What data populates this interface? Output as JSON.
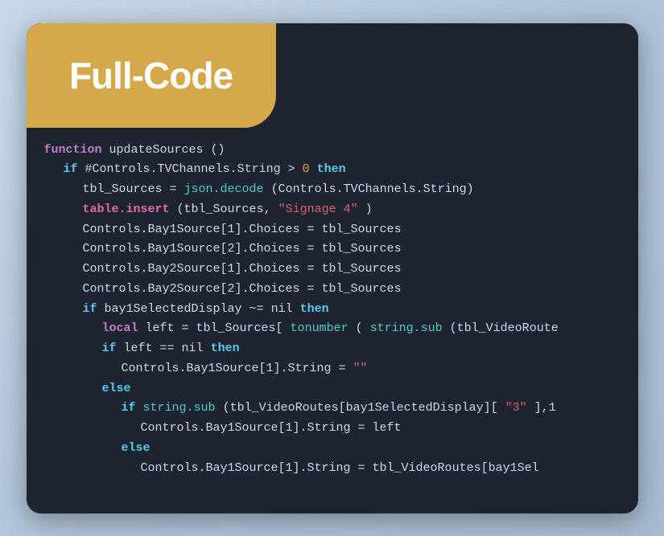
{
  "header": {
    "title": "Full-Code"
  },
  "code": {
    "lines": [
      {
        "indent": 0,
        "content": "function updateSources ()"
      },
      {
        "indent": 1,
        "content": "if #Controls.TVChannels.String > 0 then"
      },
      {
        "indent": 2,
        "content": "tbl_Sources = json.decode(Controls.TVChannels.String)"
      },
      {
        "indent": 2,
        "content": "table.insert(tbl_Sources, \"Signage 4\")"
      },
      {
        "indent": 2,
        "content": "Controls.Bay1Source[1].Choices = tbl_Sources"
      },
      {
        "indent": 2,
        "content": "Controls.Bay1Source[2].Choices = tbl_Sources"
      },
      {
        "indent": 2,
        "content": "Controls.Bay2Source[1].Choices = tbl_Sources"
      },
      {
        "indent": 2,
        "content": "Controls.Bay2Source[2].Choices = tbl_Sources"
      },
      {
        "indent": 2,
        "content": "if bay1SelectedDisplay ~= nil then"
      },
      {
        "indent": 3,
        "content": "local left = tbl_Sources[tonumber(string.sub(tbl_VideoRoute"
      },
      {
        "indent": 3,
        "content": "if left == nil then"
      },
      {
        "indent": 4,
        "content": "Controls.Bay1Source[1].String = \"\""
      },
      {
        "indent": 3,
        "content": "else"
      },
      {
        "indent": 4,
        "content": "if string.sub(tbl_VideoRoutes[bay1SelectedDisplay][\"3\"],1"
      },
      {
        "indent": 5,
        "content": "Controls.Bay1Source[1].String = left"
      },
      {
        "indent": 4,
        "content": "else"
      },
      {
        "indent": 5,
        "content": "Controls.Bay1Source[1].String = tbl_VideoRoutes[bay1Sel"
      }
    ]
  }
}
